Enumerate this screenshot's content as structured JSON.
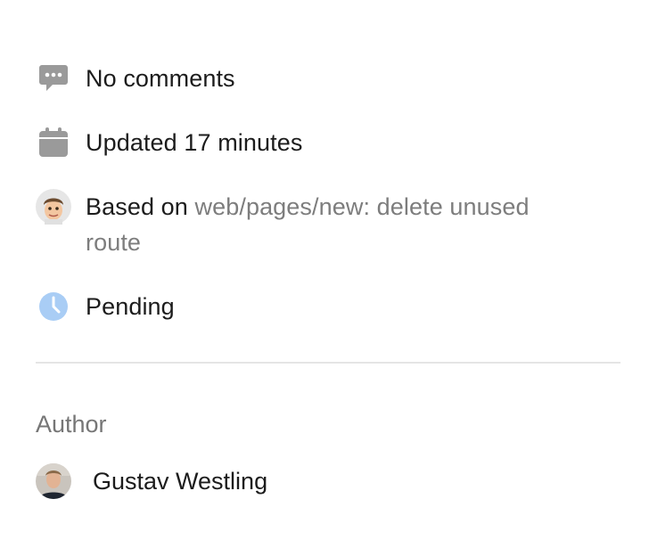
{
  "meta": {
    "comments": {
      "icon": "comment-bubble-icon",
      "text": "No comments"
    },
    "updated": {
      "icon": "calendar-icon",
      "text": "Updated 17 minutes"
    },
    "based_on": {
      "icon": "memoji-avatar-icon",
      "prefix": "Based on",
      "link_text": "web/pages/new: delete unused route"
    },
    "status": {
      "icon": "clock-icon",
      "text": "Pending"
    }
  },
  "author_section": {
    "title": "Author",
    "author_name": "Gustav Westling"
  },
  "colors": {
    "icon_gray": "#9a9a9a",
    "link_gray": "#7d7d7d",
    "pending_blue": "#a9cdf5",
    "divider": "#e5e5e5"
  }
}
